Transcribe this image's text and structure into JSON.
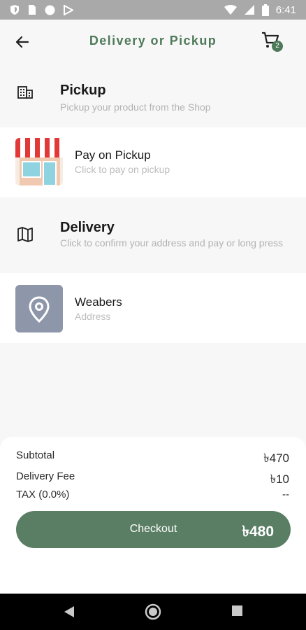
{
  "status_bar": {
    "time": "6:41"
  },
  "header": {
    "title": "Delivery or Pickup",
    "cart_count": "2"
  },
  "pickup": {
    "title": "Pickup",
    "subtitle": "Pickup your product from the Shop",
    "option": {
      "title": "Pay on Pickup",
      "subtitle": "Click to pay on pickup"
    }
  },
  "delivery": {
    "title": "Delivery",
    "subtitle": "Click to confirm your address and pay or long press",
    "address": {
      "title": "Weabers",
      "subtitle": "Address"
    }
  },
  "summary": {
    "subtotal_label": "Subtotal",
    "subtotal_value": "৳470",
    "delivery_fee_label": "Delivery Fee",
    "delivery_fee_value": "৳10",
    "tax_label": "TAX (0.0%)",
    "tax_value": "--",
    "checkout_label": "Checkout",
    "checkout_total": "৳480"
  },
  "colors": {
    "accent": "#4f7a5a",
    "checkout_bg": "#597e63",
    "status_bar": "#a9a9a9"
  }
}
